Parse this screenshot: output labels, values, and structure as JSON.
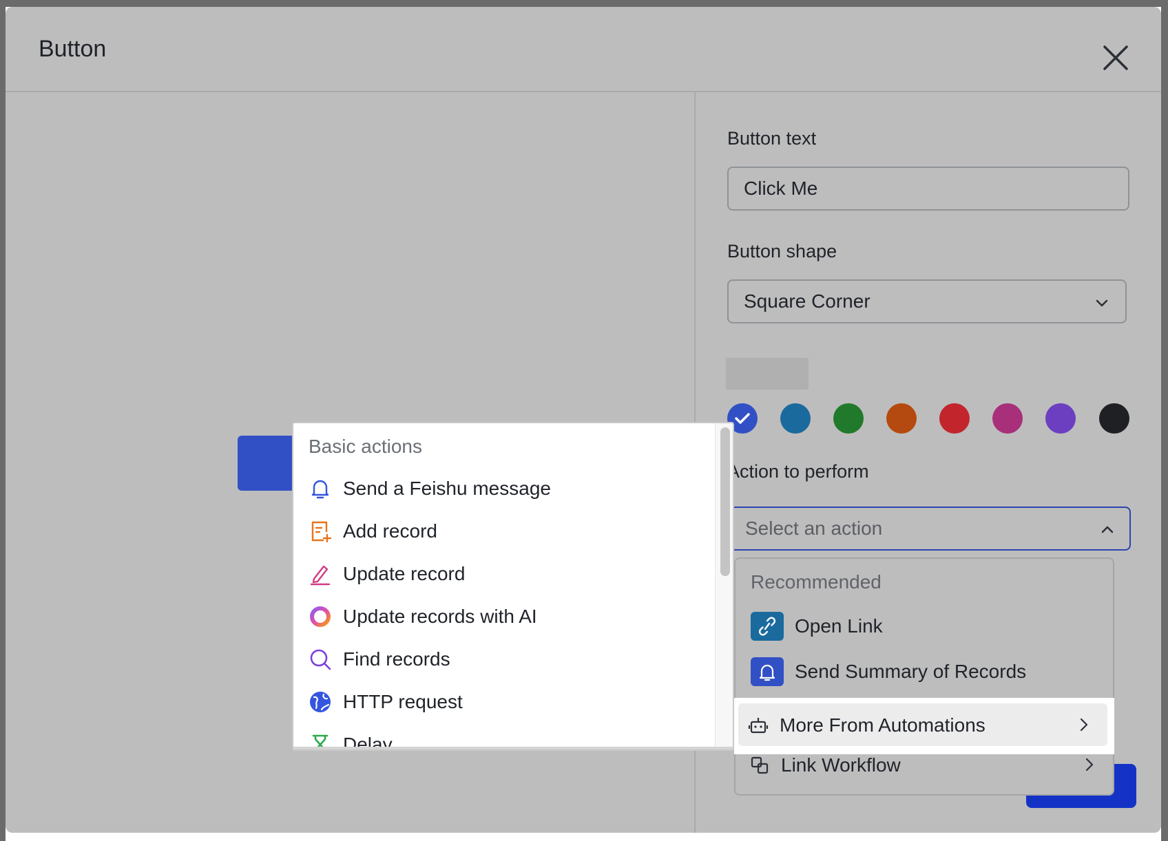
{
  "dialog": {
    "title": "Button"
  },
  "form": {
    "button_text_label": "Button text",
    "button_text_value": "Click Me",
    "button_shape_label": "Button shape",
    "button_shape_value": "Square Corner",
    "colors": [
      {
        "name": "blue",
        "hex": "#3250c5",
        "selected": true
      },
      {
        "name": "teal-blue",
        "hex": "#1a6a9e",
        "selected": false
      },
      {
        "name": "green",
        "hex": "#217a2b",
        "selected": false
      },
      {
        "name": "orange",
        "hex": "#b54a10",
        "selected": false
      },
      {
        "name": "red",
        "hex": "#c2262c",
        "selected": false
      },
      {
        "name": "magenta",
        "hex": "#a8307a",
        "selected": false
      },
      {
        "name": "purple",
        "hex": "#6b3fc0",
        "selected": false
      },
      {
        "name": "black",
        "hex": "#1f2023",
        "selected": false
      }
    ],
    "action_label": "Action to perform",
    "action_placeholder": "Select an action"
  },
  "recommended_menu": {
    "section_title": "Recommended",
    "items": [
      {
        "label": "Open Link",
        "icon": "link-icon"
      },
      {
        "label": "Send Summary of Records",
        "icon": "bell-icon"
      }
    ],
    "more_automations": {
      "label": "More From Automations",
      "icon": "robot-icon"
    },
    "link_workflow": {
      "label": "Link Workflow",
      "icon": "workflow-icon"
    }
  },
  "basic_menu": {
    "section_title": "Basic actions",
    "items": [
      {
        "label": "Send a Feishu message",
        "icon": "bell-icon"
      },
      {
        "label": "Add record",
        "icon": "add-record-icon"
      },
      {
        "label": "Update record",
        "icon": "pencil-icon"
      },
      {
        "label": "Update records with AI",
        "icon": "ai-ring-icon"
      },
      {
        "label": "Find records",
        "icon": "search-icon"
      },
      {
        "label": "HTTP request",
        "icon": "globe-icon"
      },
      {
        "label": "Delay",
        "icon": "hourglass-icon"
      }
    ]
  }
}
